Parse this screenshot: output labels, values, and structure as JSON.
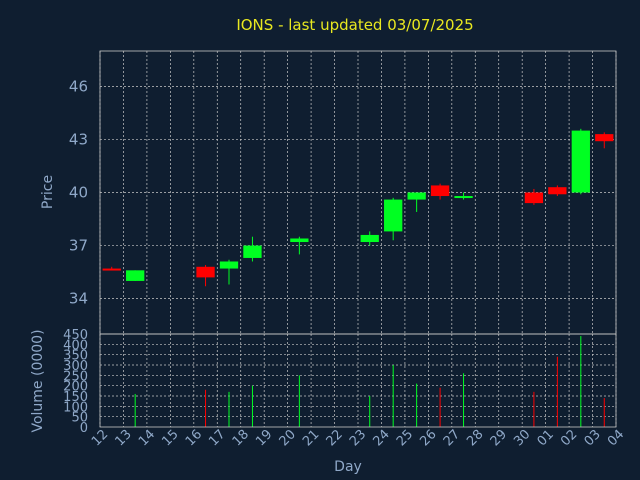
{
  "chart_data": [
    {
      "type": "candlestick",
      "title": "IONS - last updated 03/07/2025",
      "ylabel": "Price",
      "ylim": [
        32,
        48
      ],
      "yticks": [
        34,
        37,
        40,
        43,
        46
      ],
      "grid": true,
      "colors": {
        "up": "#00ff22",
        "down": "#ff0000"
      },
      "candles": [
        {
          "day": "12",
          "open": 35.7,
          "high": 35.8,
          "low": 35.6,
          "close": 35.6
        },
        {
          "day": "13",
          "open": 35.0,
          "high": 35.6,
          "low": 35.0,
          "close": 35.6
        },
        {
          "day": "16",
          "open": 35.8,
          "high": 35.9,
          "low": 34.7,
          "close": 35.2
        },
        {
          "day": "17",
          "open": 35.7,
          "high": 36.2,
          "low": 34.8,
          "close": 36.1
        },
        {
          "day": "18",
          "open": 36.3,
          "high": 37.5,
          "low": 36.1,
          "close": 37.0
        },
        {
          "day": "20",
          "open": 37.2,
          "high": 37.5,
          "low": 36.5,
          "close": 37.4
        },
        {
          "day": "23",
          "open": 37.2,
          "high": 37.8,
          "low": 37.0,
          "close": 37.6
        },
        {
          "day": "24",
          "open": 37.8,
          "high": 39.7,
          "low": 37.3,
          "close": 39.6
        },
        {
          "day": "25",
          "open": 39.6,
          "high": 40.0,
          "low": 38.9,
          "close": 40.0
        },
        {
          "day": "26",
          "open": 40.4,
          "high": 40.5,
          "low": 39.6,
          "close": 39.8
        },
        {
          "day": "27",
          "open": 39.7,
          "high": 40.0,
          "low": 39.6,
          "close": 39.8
        },
        {
          "day": "30",
          "open": 40.0,
          "high": 40.2,
          "low": 39.3,
          "close": 39.4
        },
        {
          "day": "01",
          "open": 40.3,
          "high": 40.4,
          "low": 39.8,
          "close": 39.9
        },
        {
          "day": "02",
          "open": 40.0,
          "high": 43.6,
          "low": 39.9,
          "close": 43.5
        },
        {
          "day": "03",
          "open": 43.3,
          "high": 43.4,
          "low": 42.5,
          "close": 42.9
        }
      ]
    },
    {
      "type": "bar",
      "ylabel": "Volume (0000)",
      "xlabel": "Day",
      "ylim": [
        0,
        450
      ],
      "yticks": [
        0,
        50,
        100,
        150,
        200,
        250,
        300,
        350,
        400,
        450
      ],
      "grid": true,
      "categories": [
        "12",
        "13",
        "14",
        "15",
        "16",
        "17",
        "18",
        "19",
        "20",
        "21",
        "22",
        "23",
        "24",
        "25",
        "26",
        "27",
        "28",
        "29",
        "30",
        "01",
        "02",
        "03",
        "04"
      ],
      "bars": [
        {
          "day": "13",
          "value": 160,
          "dir": "up"
        },
        {
          "day": "16",
          "value": 180,
          "dir": "down"
        },
        {
          "day": "17",
          "value": 170,
          "dir": "up"
        },
        {
          "day": "18",
          "value": 200,
          "dir": "up"
        },
        {
          "day": "20",
          "value": 250,
          "dir": "up"
        },
        {
          "day": "23",
          "value": 150,
          "dir": "up"
        },
        {
          "day": "24",
          "value": 300,
          "dir": "up"
        },
        {
          "day": "25",
          "value": 210,
          "dir": "up"
        },
        {
          "day": "26",
          "value": 190,
          "dir": "down"
        },
        {
          "day": "27",
          "value": 260,
          "dir": "up"
        },
        {
          "day": "30",
          "value": 170,
          "dir": "down"
        },
        {
          "day": "01",
          "value": 340,
          "dir": "down"
        },
        {
          "day": "02",
          "value": 440,
          "dir": "up"
        },
        {
          "day": "03",
          "value": 140,
          "dir": "down"
        }
      ]
    }
  ]
}
